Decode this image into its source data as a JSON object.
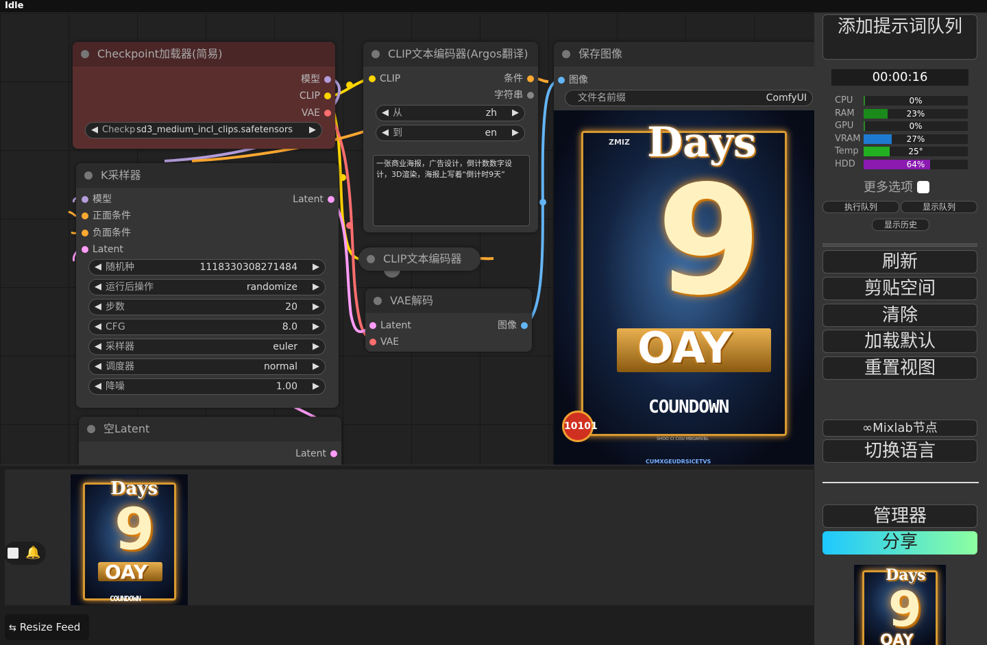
{
  "status": "Idle",
  "nodes": {
    "checkpoint": {
      "title": "Checkpoint加载器(简易)",
      "out_model": "模型",
      "out_clip": "CLIP",
      "out_vae": "VAE",
      "ckpt_name": "sd3_medium_incl_clips.safetensors",
      "ckpt_label": "Checkp"
    },
    "clip_argos": {
      "title": "CLIP文本编码器(Argos翻译)",
      "in_clip": "CLIP",
      "out_cond": "条件",
      "out_string": "字符串",
      "from_label": "从",
      "from_value": "zh",
      "to_label": "到",
      "to_value": "en",
      "text": "一张商业海报，广告设计，倒计数数字设计，3D渲染，海报上写着“倒计时9天”"
    },
    "save": {
      "title": "保存图像",
      "in_image": "图像",
      "prefix_label": "文件名前缀",
      "prefix_value": "ComfyUI"
    },
    "ksampler": {
      "title": "K采样器",
      "in_model": "模型",
      "in_pos": "正面条件",
      "in_neg": "负面条件",
      "in_latent": "Latent",
      "out_latent": "Latent",
      "widgets": [
        {
          "label": "随机种",
          "value": "1118330308271484"
        },
        {
          "label": "运行后操作",
          "value": "randomize"
        },
        {
          "label": "步数",
          "value": "20"
        },
        {
          "label": "CFG",
          "value": "8.0"
        },
        {
          "label": "采样器",
          "value": "euler"
        },
        {
          "label": "调度器",
          "value": "normal"
        },
        {
          "label": "降噪",
          "value": "1.00"
        }
      ]
    },
    "clip2": {
      "title": "CLIP文本编码器"
    },
    "vae": {
      "title": "VAE解码",
      "in_latent": "Latent",
      "in_vae": "VAE",
      "out_image": "图像"
    },
    "empty_latent": {
      "title": "空Latent",
      "out_latent": "Latent"
    }
  },
  "poster": {
    "title": "Days",
    "number": "9",
    "band": "OAY",
    "countdown": "COUNDOWN",
    "brand": "ZMIZ",
    "badge": "10101",
    "fine": "SHOO CI COU MBOAREBL",
    "footer": "CUMXGEUDRSICETVS"
  },
  "feed": {
    "resize_label": "Resize Feed"
  },
  "panel": {
    "queue_prompt": "添加提示词队列",
    "timer": "00:00:16",
    "stats": [
      {
        "name": "CPU",
        "pct": "0%",
        "fill": 0.0,
        "color": "#2a8a2a"
      },
      {
        "name": "RAM",
        "pct": "23%",
        "fill": 0.23,
        "color": "#1a8a1a"
      },
      {
        "name": "GPU",
        "pct": "0%",
        "fill": 0.0,
        "color": "#2a8a2a"
      },
      {
        "name": "VRAM",
        "pct": "27%",
        "fill": 0.27,
        "color": "#1e7ad0"
      },
      {
        "name": "Temp",
        "pct": "25°",
        "fill": 0.25,
        "color": "#22b022"
      },
      {
        "name": "HDD",
        "pct": "64%",
        "fill": 0.64,
        "color": "#8a1ab0"
      }
    ],
    "more_options": "更多选项",
    "view_queue": "执行队列",
    "show_queue": "显示队列",
    "show_history": "显示历史",
    "refresh": "刷新",
    "clipspace": "剪贴空间",
    "clear": "清除",
    "load_default": "加载默认",
    "reset_view": "重置视图",
    "mixlab": "Mixlab节点",
    "switch_lang": "切换语言",
    "manager": "管理器",
    "share": "分享"
  },
  "colors": {
    "model": "#b39ddb",
    "clip": "#ffd500",
    "vae": "#ff6e6e",
    "cond": "#ffa931",
    "latent": "#ff9cf9",
    "image": "#64b5f6"
  }
}
